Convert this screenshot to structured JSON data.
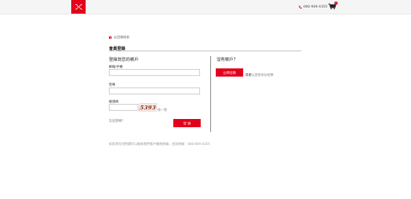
{
  "header": {
    "phone": "080-909-0355",
    "cart_count": "0",
    "brand_color": "#e3001b"
  },
  "nav": {
    "back_label": "返回購物車"
  },
  "page": {
    "section_title": "會員登錄"
  },
  "login": {
    "heading": "登錄到您的帳戶",
    "email_label": "郵箱/手機",
    "email_value": "",
    "password_label": "密碼",
    "password_value": "",
    "captcha_label": "驗證碼",
    "captcha_value": "",
    "captcha_code": "5393",
    "refresh_label": "換一張",
    "forgot_label": "忘記密碼？",
    "submit_label": "登 錄"
  },
  "register": {
    "heading": "沒有賬戶？",
    "button_label": "立即註冊",
    "or_label": "或者",
    "guest_label": "以遊客身份結算"
  },
  "footer": {
    "note": "如您有任何問題可以聯系我們客戶服務熱線，咨詢熱線：080-909-0355"
  },
  "icons": {
    "logo": "under-armour-logo-icon",
    "phone": "phone-icon",
    "cart": "cart-icon",
    "back": "back-arrow-icon"
  }
}
